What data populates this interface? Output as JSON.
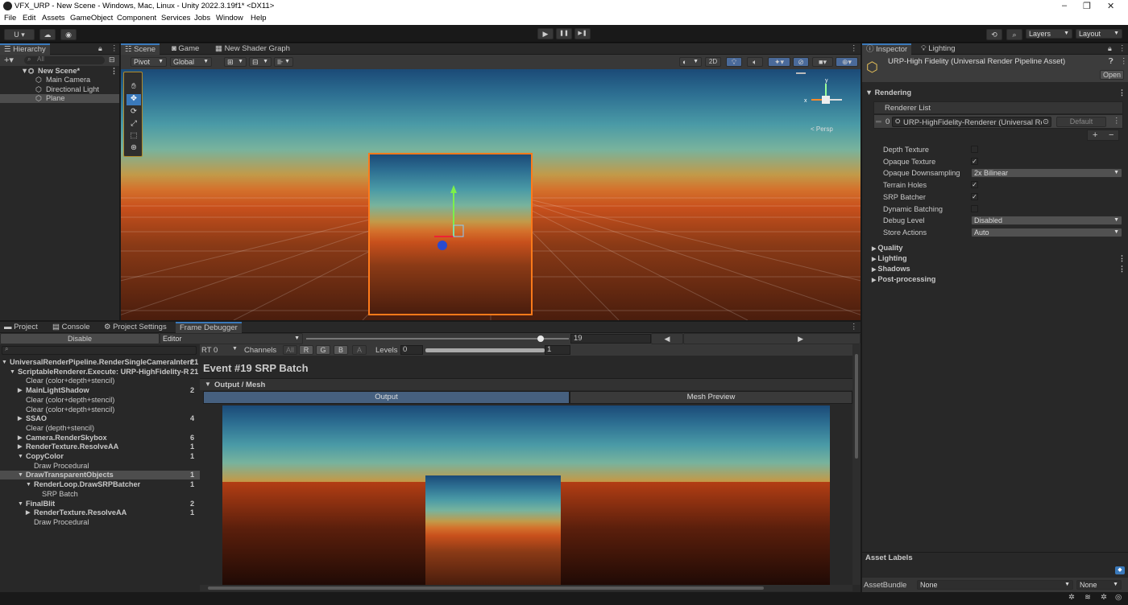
{
  "window": {
    "title": "VFX_URP - New Scene - Windows, Mac, Linux - Unity 2022.3.19f1* <DX11>",
    "controls": [
      "–",
      "❐",
      "✕"
    ]
  },
  "menu": [
    "File",
    "Edit",
    "Assets",
    "GameObject",
    "Component",
    "Services",
    "Jobs",
    "Window",
    "Help"
  ],
  "toolbar": {
    "account": "U ▾",
    "play": "▶",
    "pause": "❚❚",
    "step": "▶❚",
    "layers": "Layers",
    "layout": "Layout"
  },
  "hierarchy": {
    "tab": "Hierarchy",
    "search_placeholder": "All",
    "scene": "New Scene*",
    "items": [
      "Main Camera",
      "Directional Light",
      "Plane"
    ]
  },
  "scene_tabs": [
    "Scene",
    "Game",
    "New Shader Graph"
  ],
  "scene_toolbar": {
    "pivot": "Pivot",
    "global": "Global",
    "two_d": "2D",
    "persp": "< Persp"
  },
  "inspector": {
    "tabs": [
      "Inspector",
      "Lighting"
    ],
    "asset_title": "URP-High Fidelity (Universal Render Pipeline Asset)",
    "open": "Open",
    "section_rendering": "Rendering",
    "renderer_list_label": "Renderer List",
    "renderer_index": "0",
    "renderer_value": "URP-HighFidelity-Renderer (Universal Rei",
    "renderer_default": "Default",
    "props": [
      {
        "label": "Depth Texture",
        "type": "checkbox",
        "checked": false
      },
      {
        "label": "Opaque Texture",
        "type": "checkbox",
        "checked": true
      },
      {
        "label": "Opaque Downsampling",
        "type": "dropdown",
        "value": "2x Bilinear"
      },
      {
        "label": "Terrain Holes",
        "type": "checkbox",
        "checked": true
      },
      {
        "label": "SRP Batcher",
        "type": "checkbox",
        "checked": true
      },
      {
        "label": "Dynamic Batching",
        "type": "checkbox",
        "checked": false
      },
      {
        "label": "Debug Level",
        "type": "dropdown",
        "value": "Disabled"
      },
      {
        "label": "Store Actions",
        "type": "dropdown",
        "value": "Auto"
      }
    ],
    "sections": [
      "Quality",
      "Lighting",
      "Shadows",
      "Post-processing"
    ],
    "asset_labels": "Asset Labels",
    "asset_bundle_label": "AssetBundle",
    "asset_bundle_value": "None",
    "asset_bundle_variant": "None"
  },
  "bottom_tabs": [
    "Project",
    "Console",
    "Project Settings",
    "Frame Debugger"
  ],
  "frame_debugger": {
    "disable": "Disable",
    "editor": "Editor",
    "event_index": "19",
    "rt": "RT 0",
    "channels_label": "Channels",
    "channels": [
      "All",
      "R",
      "G",
      "B",
      "A"
    ],
    "levels_label": "Levels",
    "levels_min": "0",
    "levels_max": "1",
    "event_title": "Event #19 SRP Batch",
    "output_mesh": "Output / Mesh",
    "output_tab": "Output",
    "mesh_preview_tab": "Mesh Preview",
    "events": [
      {
        "label": "UniversalRenderPipeline.RenderSingleCameraInterr",
        "count": "21",
        "indent": 0,
        "arrow": "▼",
        "bold": true
      },
      {
        "label": "ScriptableRenderer.Execute: URP-HighFidelity-R",
        "count": "21",
        "indent": 1,
        "arrow": "▼",
        "bold": true
      },
      {
        "label": "Clear (color+depth+stencil)",
        "count": "",
        "indent": 2,
        "arrow": "",
        "bold": false
      },
      {
        "label": "MainLightShadow",
        "count": "2",
        "indent": 2,
        "arrow": "▶",
        "bold": true
      },
      {
        "label": "Clear (color+depth+stencil)",
        "count": "",
        "indent": 2,
        "arrow": "",
        "bold": false
      },
      {
        "label": "Clear (color+depth+stencil)",
        "count": "",
        "indent": 2,
        "arrow": "",
        "bold": false
      },
      {
        "label": "SSAO",
        "count": "4",
        "indent": 2,
        "arrow": "▶",
        "bold": true
      },
      {
        "label": "Clear (depth+stencil)",
        "count": "",
        "indent": 2,
        "arrow": "",
        "bold": false
      },
      {
        "label": "Camera.RenderSkybox",
        "count": "6",
        "indent": 2,
        "arrow": "▶",
        "bold": true
      },
      {
        "label": "RenderTexture.ResolveAA",
        "count": "1",
        "indent": 2,
        "arrow": "▶",
        "bold": true
      },
      {
        "label": "CopyColor",
        "count": "1",
        "indent": 2,
        "arrow": "▼",
        "bold": true
      },
      {
        "label": "Draw Procedural",
        "count": "",
        "indent": 3,
        "arrow": "",
        "bold": false
      },
      {
        "label": "DrawTransparentObjects",
        "count": "1",
        "indent": 2,
        "arrow": "▼",
        "bold": true,
        "selected": true
      },
      {
        "label": "RenderLoop.DrawSRPBatcher",
        "count": "1",
        "indent": 3,
        "arrow": "▼",
        "bold": true
      },
      {
        "label": "SRP Batch",
        "count": "",
        "indent": 4,
        "arrow": "",
        "bold": false
      },
      {
        "label": "FinalBlit",
        "count": "2",
        "indent": 2,
        "arrow": "▼",
        "bold": true
      },
      {
        "label": "RenderTexture.ResolveAA",
        "count": "1",
        "indent": 3,
        "arrow": "▶",
        "bold": true
      },
      {
        "label": "Draw Procedural",
        "count": "",
        "indent": 3,
        "arrow": "",
        "bold": false
      }
    ]
  },
  "colors": {
    "selection": "#2c5d87",
    "accent_tab": "#3a79bb",
    "selected_outline": "#ff7a1a"
  }
}
